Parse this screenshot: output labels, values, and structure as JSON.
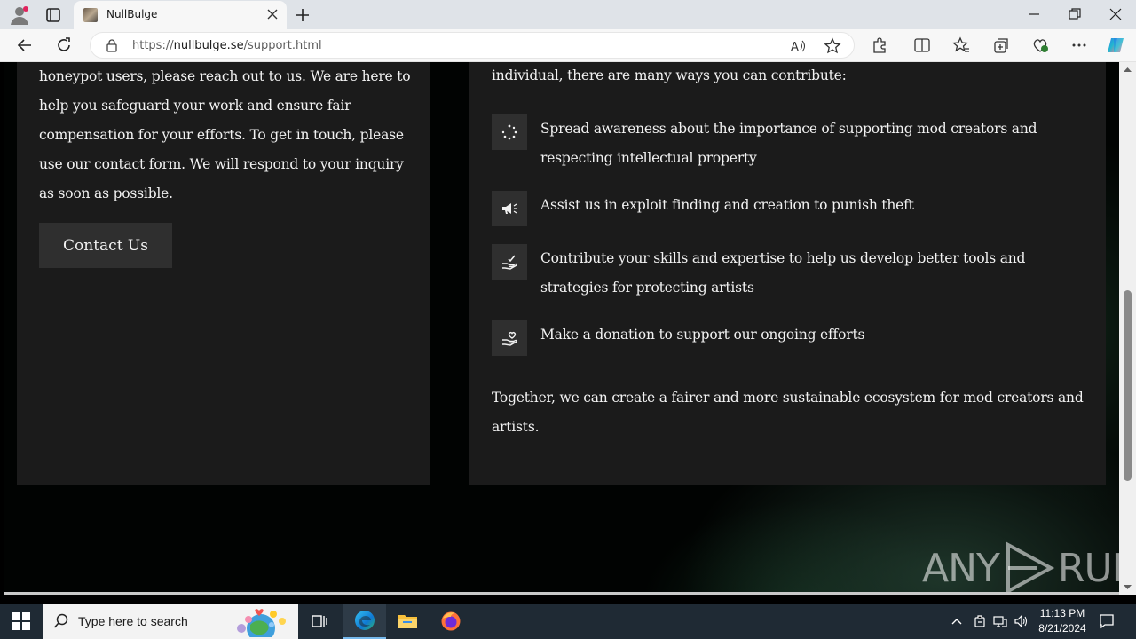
{
  "browser": {
    "tab_title": "NullBulge",
    "url_prefix": "https://",
    "url_host": "nullbulge.se",
    "url_path": "/support.html"
  },
  "page": {
    "left_text": "honeypot users, please reach out to us. We are here to help you safeguard your work and ensure fair compensation for your efforts. To get in touch, please use our contact form. We will respond to your inquiry as soon as possible.",
    "contact_button": "Contact Us",
    "intro": "individual, there are many ways you can contribute:",
    "items": [
      {
        "icon": "loading-icon",
        "text": "Spread awareness about the importance of supporting mod creators and respecting intellectual property"
      },
      {
        "icon": "megaphone-icon",
        "text": "Assist us in exploit finding and creation to punish theft"
      },
      {
        "icon": "hand-check-icon",
        "text": "Contribute your skills and expertise to help us develop better tools and strategies for protecting artists"
      },
      {
        "icon": "hand-heart-icon",
        "text": "Make a donation to support our ongoing efforts"
      }
    ],
    "outro": "Together, we can create a fairer and more sustainable ecosystem for mod creators and artists."
  },
  "watermark": {
    "left": "ANY",
    "right": "RUN"
  },
  "taskbar": {
    "search_placeholder": "Type here to search",
    "time": "11:13 PM",
    "date": "8/21/2024"
  },
  "colors": {
    "card": "#1b1b1b",
    "button": "#2f2f2f",
    "taskbar": "#1f2a34",
    "accent": "#76b9ed"
  }
}
